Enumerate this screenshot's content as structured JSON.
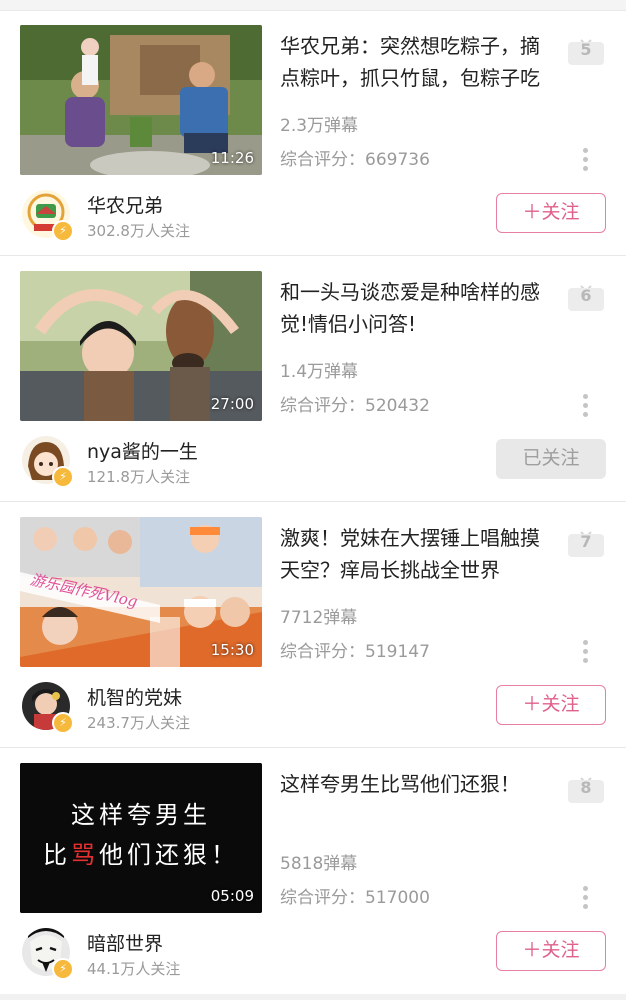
{
  "videos": [
    {
      "title": "华农兄弟：突然想吃粽子，摘点粽叶，抓只竹鼠，包粽子吃",
      "duration": "11:26",
      "rank": "5",
      "danmaku": "2.3万弹幕",
      "score": "综合评分：669736",
      "uploader": "华农兄弟",
      "followers": "302.8万人关注",
      "follow_label": "＋关注",
      "followed": false
    },
    {
      "title": "和一头马谈恋爱是种啥样的感觉!情侣小问答!",
      "duration": "27:00",
      "rank": "6",
      "danmaku": "1.4万弹幕",
      "score": "综合评分：520432",
      "uploader": "nya酱的一生",
      "followers": "121.8万人关注",
      "follow_label": "已关注",
      "followed": true
    },
    {
      "title": "激爽！党妹在大摆锤上唱触摸天空？痒局长挑战全世界",
      "duration": "15:30",
      "rank": "7",
      "danmaku": "7712弹幕",
      "score": "综合评分：519147",
      "uploader": "机智的党妹",
      "followers": "243.7万人关注",
      "follow_label": "＋关注",
      "followed": false,
      "thumb_text": "游乐园作死Vlog"
    },
    {
      "title": "这样夸男生比骂他们还狠！",
      "duration": "05:09",
      "rank": "8",
      "danmaku": "5818弹幕",
      "score": "综合评分：517000",
      "uploader": "暗部世界",
      "followers": "44.1万人关注",
      "follow_label": "＋关注",
      "followed": false,
      "thumb_line1": "这样夸男生",
      "thumb_line2_a": "比",
      "thumb_line2_b": "骂",
      "thumb_line2_c": "他们还狠！"
    }
  ],
  "colors": {
    "accent_pink": "#e0608a",
    "muted_text": "#9a9a9a",
    "badge_yellow": "#f6b93b"
  },
  "icons": {
    "rank_badge": "tv-rank-icon",
    "more": "more-vertical-icon",
    "verified": "verified-badge-icon"
  }
}
